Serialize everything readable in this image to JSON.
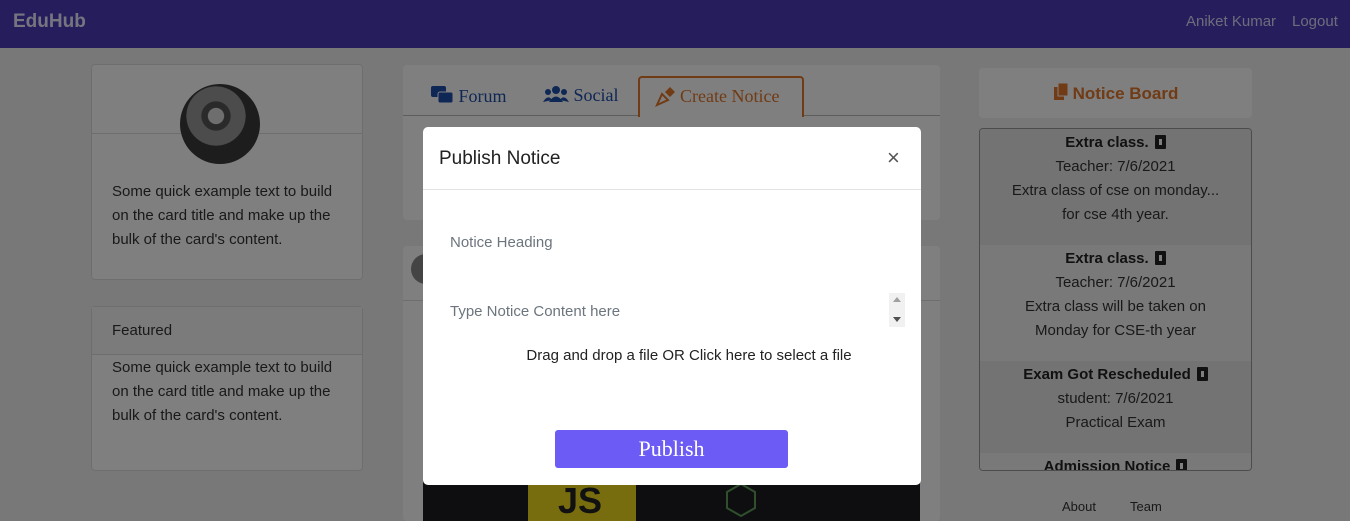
{
  "navbar": {
    "brand": "EduHub",
    "user_name": "Aniket Kumar",
    "logout_label": "Logout"
  },
  "left_cards": [
    {
      "text": "Some quick example text to build on the card title and make up the bulk of the card's content."
    },
    {
      "header": "Featured",
      "text": "Some quick example text to build on the card title and make up the bulk of the card's content."
    }
  ],
  "tabs": [
    {
      "label": "Forum",
      "icon": "forum-icon"
    },
    {
      "label": "Social",
      "icon": "users-icon"
    },
    {
      "label": "Create Notice",
      "icon": "pen-nib-icon",
      "active": true
    }
  ],
  "notice_board": {
    "title": "Notice Board",
    "items": [
      {
        "heading": "Extra class.",
        "meta": "Teacher: 7/6/2021",
        "lines": [
          "Extra class of cse on monday...",
          "for cse 4th year."
        ]
      },
      {
        "heading": "Extra class.",
        "meta": "Teacher: 7/6/2021",
        "lines": [
          "Extra class will be taken on",
          "Monday for CSE-th year"
        ]
      },
      {
        "heading": "Exam Got Rescheduled",
        "meta": "student: 7/6/2021",
        "lines": [
          "Practical Exam"
        ]
      },
      {
        "heading": "Admission Notice",
        "meta": "",
        "lines": []
      }
    ]
  },
  "footer": {
    "links": [
      "About",
      "Team"
    ]
  },
  "modal": {
    "title": "Publish Notice",
    "close_label": "×",
    "heading_placeholder": "Notice Heading",
    "content_placeholder": "Type Notice Content here",
    "dropzone_text": "Drag and drop a file OR Click here to select a file",
    "publish_label": "Publish"
  },
  "colors": {
    "navbar": "#4a3ab8",
    "accent_orange": "#e0762b",
    "tab_blue": "#1d4fa8",
    "publish_button": "#6c5cf5"
  }
}
